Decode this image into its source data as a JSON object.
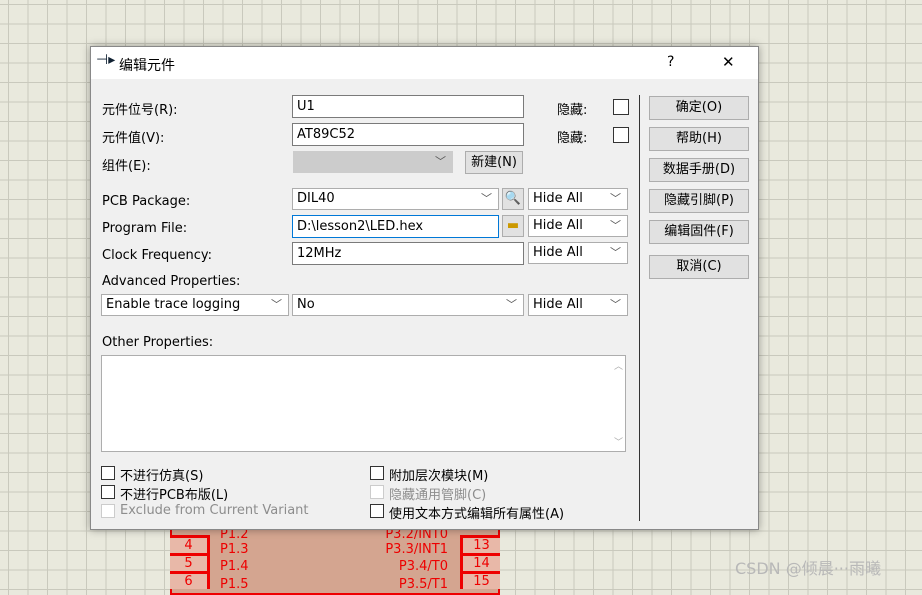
{
  "schematic": {
    "pins_left": [
      "4",
      "5",
      "6"
    ],
    "left_labels": [
      "P1.2",
      "P1.3",
      "P1.4",
      "P1.5"
    ],
    "right_labels": [
      "P3.2/INT0",
      "P3.3/INT1",
      "P3.4/T0",
      "P3.5/T1"
    ],
    "pins_right": [
      "13",
      "14",
      "15"
    ]
  },
  "watermark": "CSDN @倾晨···雨曦",
  "dialog": {
    "title": "编辑元件",
    "help": "?",
    "close": "✕",
    "fields": {
      "ref_label": "元件位号(R):",
      "ref_value": "U1",
      "ref_hide": "隐藏:",
      "value_label": "元件值(V):",
      "value_value": "AT89C52",
      "value_hide": "隐藏:",
      "group_label": "组件(E):",
      "group_value": "",
      "new_button": "新建(N)",
      "pcb_label": "PCB Package:",
      "pcb_value": "DIL40",
      "pcb_vis": "Hide All",
      "prog_label": "Program File:",
      "prog_value": "D:\\lesson2\\LED.hex",
      "prog_vis": "Hide All",
      "clock_label": "Clock Frequency:",
      "clock_value": "12MHz",
      "clock_vis": "Hide All",
      "adv_label": "Advanced Properties:",
      "adv_prop": "Enable trace logging",
      "adv_value": "No",
      "adv_vis": "Hide All",
      "other_label": "Other Properties:",
      "other_value": ""
    },
    "checkboxes": [
      {
        "label": "不进行仿真(S)",
        "checked": false,
        "enabled": true
      },
      {
        "label": "不进行PCB布版(L)",
        "checked": false,
        "enabled": true
      },
      {
        "label": "Exclude from Current Variant",
        "checked": false,
        "enabled": false
      },
      {
        "label": "附加层次模块(M)",
        "checked": false,
        "enabled": true
      },
      {
        "label": "隐藏通用管脚(C)",
        "checked": false,
        "enabled": false
      },
      {
        "label": "使用文本方式编辑所有属性(A)",
        "checked": false,
        "enabled": true
      }
    ],
    "buttons": [
      "确定(O)",
      "帮助(H)",
      "数据手册(D)",
      "隐藏引脚(P)",
      "编辑固件(F)",
      "取消(C)"
    ]
  }
}
